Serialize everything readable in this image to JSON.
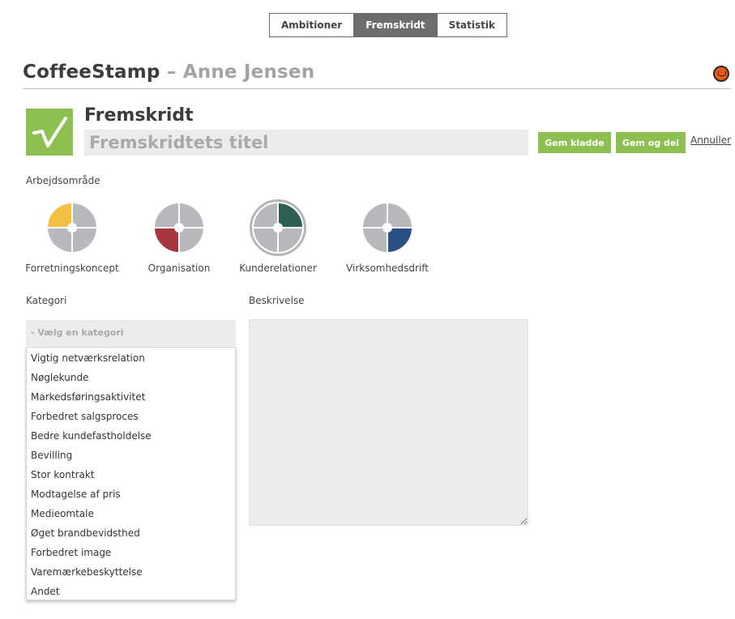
{
  "tabs": [
    {
      "label": "Ambitioner",
      "active": false
    },
    {
      "label": "Fremskridt",
      "active": true
    },
    {
      "label": "Statistik",
      "active": false
    }
  ],
  "header": {
    "brand": "CoffeeStamp",
    "separator": "–",
    "user": "Anne Jensen"
  },
  "form": {
    "section_title": "Fremskridt",
    "title_placeholder": "Fremskridtets titel",
    "title_value": "",
    "save_draft_label": "Gem kladde",
    "save_share_label": "Gem og del",
    "cancel_label": "Annuller"
  },
  "work_area": {
    "label": "Arbejdsområde",
    "items": [
      {
        "label": "Forretningskoncept",
        "color": "#f2c144",
        "selected": false
      },
      {
        "label": "Organisation",
        "color": "#a8343e",
        "selected": false
      },
      {
        "label": "Kunderelationer",
        "color": "#2e5f52",
        "selected": true
      },
      {
        "label": "Virksomhedsdrift",
        "color": "#2a4f86",
        "selected": false
      }
    ]
  },
  "category": {
    "label": "Kategori",
    "placeholder": "- Vælg en kategori",
    "options": [
      "Vigtig netværksrelation",
      "Nøglekunde",
      "Markedsføringsaktivitet",
      "Forbedret salgsproces",
      "Bedre kundefastholdelse",
      "Bevilling",
      "Stor kontrakt",
      "Modtagelse af pris",
      "Medieomtale",
      "Øget brandbevidsthed",
      "Forbedret image",
      "Varemærkebeskyttelse",
      "Andet"
    ]
  },
  "description": {
    "label": "Beskrivelse",
    "value": ""
  },
  "colors": {
    "accent_green": "#8cc152",
    "tab_active": "#6d6d6d",
    "input_bg": "#ececec",
    "quadrant_grey": "#b8b9bd",
    "coffee_icon": "#e8591a"
  },
  "icons": {
    "logo": "checkmark-icon",
    "profile": "coffee-cup-icon"
  }
}
